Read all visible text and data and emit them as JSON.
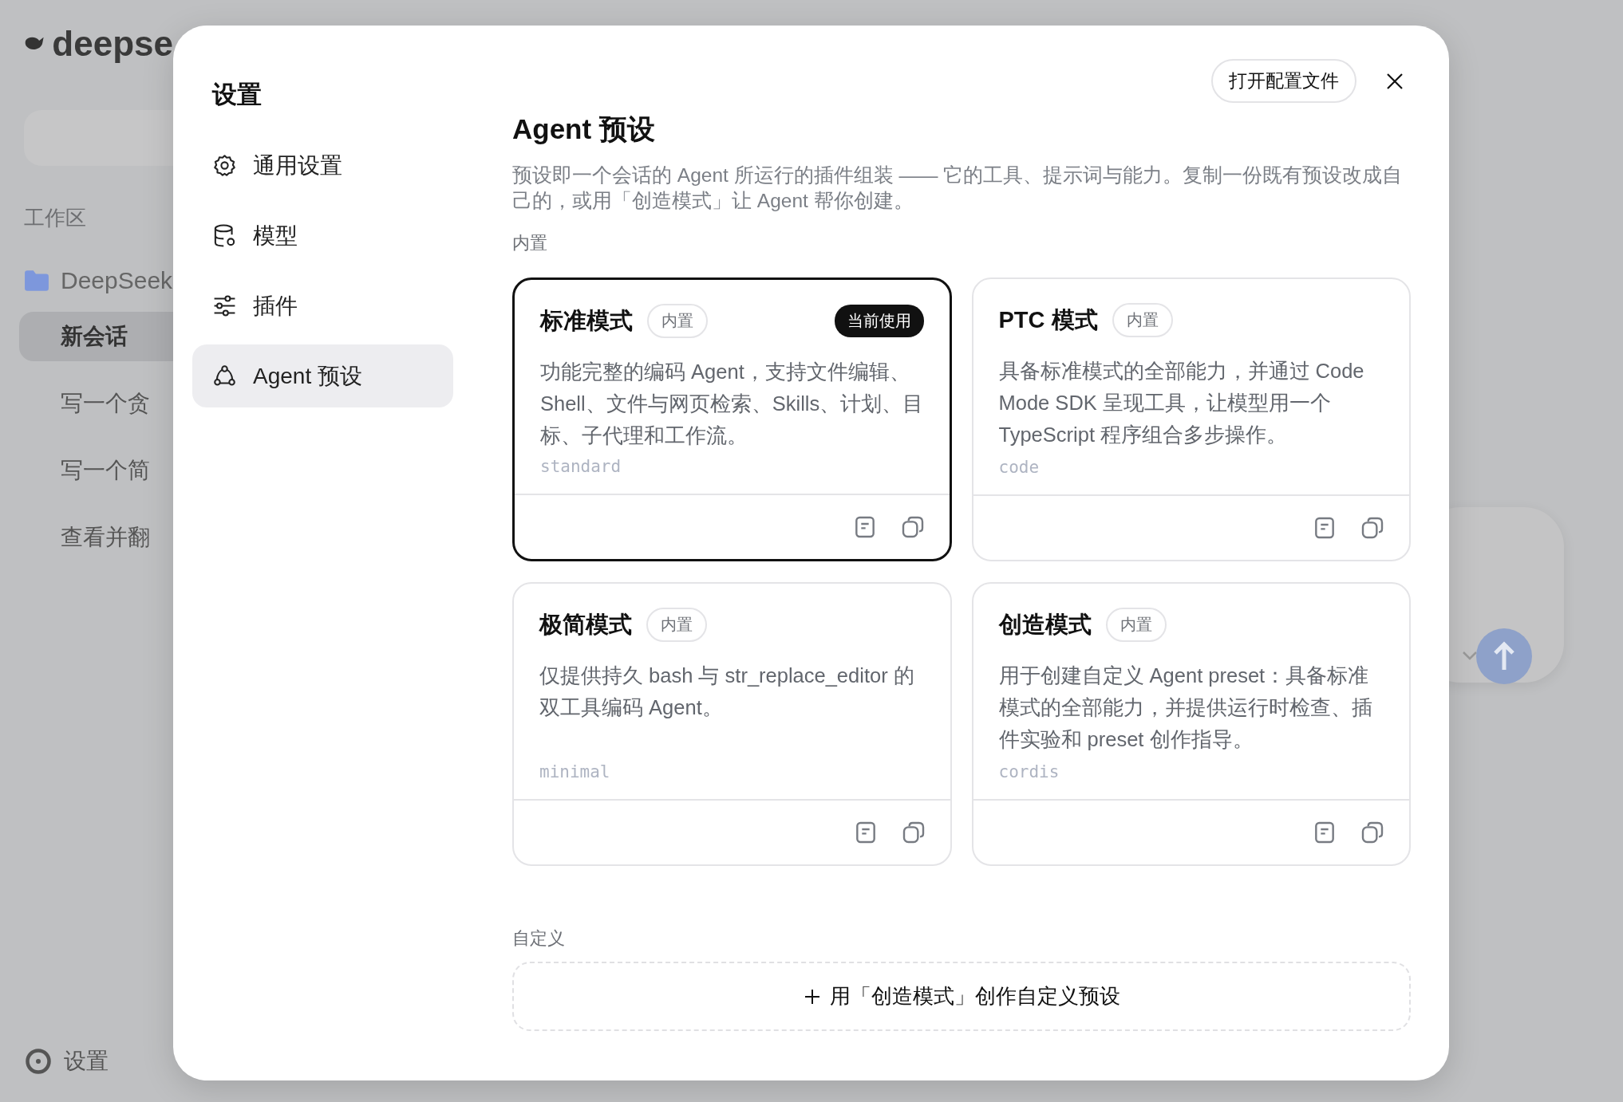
{
  "backdrop": {
    "logo": "deepse",
    "section": "工作区",
    "folder": "DeepSeek",
    "chats": [
      {
        "title": "新会话",
        "selected": true
      },
      {
        "title": "写一个贪",
        "selected": false
      },
      {
        "title": "写一个简",
        "selected": false
      },
      {
        "title": "查看并翻",
        "selected": false
      }
    ],
    "settings": "设置"
  },
  "dialog": {
    "title": "设置",
    "open_config": "打开配置文件",
    "nav": [
      {
        "label": "通用设置",
        "selected": false
      },
      {
        "label": "模型",
        "selected": false
      },
      {
        "label": "插件",
        "selected": false
      },
      {
        "label": "Agent 预设",
        "selected": true
      }
    ],
    "heading": "Agent 预设",
    "description": "预设即一个会话的 Agent 所运行的插件组装 —— 它的工具、提示词与能力。复制一份既有预设改成自己的，或用「创造模式」让 Agent 帮你创建。",
    "builtin_label": "内置",
    "presets": [
      {
        "name": "标准模式",
        "badge": "内置",
        "current_badge": "当前使用",
        "selected": true,
        "description": "功能完整的编码 Agent，支持文件编辑、Shell、文件与网页检索、Skills、计划、目标、子代理和工作流。",
        "id": "standard"
      },
      {
        "name": "PTC 模式",
        "badge": "内置",
        "selected": false,
        "description": "具备标准模式的全部能力，并通过 Code Mode SDK 呈现工具，让模型用一个 TypeScript 程序组合多步操作。",
        "id": "code"
      },
      {
        "name": "极简模式",
        "badge": "内置",
        "selected": false,
        "description": "仅提供持久 bash 与 str_replace_editor 的双工具编码 Agent。",
        "id": "minimal"
      },
      {
        "name": "创造模式",
        "badge": "内置",
        "selected": false,
        "description": "用于创建自定义 Agent preset：具备标准模式的全部能力，并提供运行时检查、插件实验和 preset 创作指导。",
        "id": "cordis"
      }
    ],
    "custom_label": "自定义",
    "create_button": "用「创造模式」创作自定义预设"
  }
}
